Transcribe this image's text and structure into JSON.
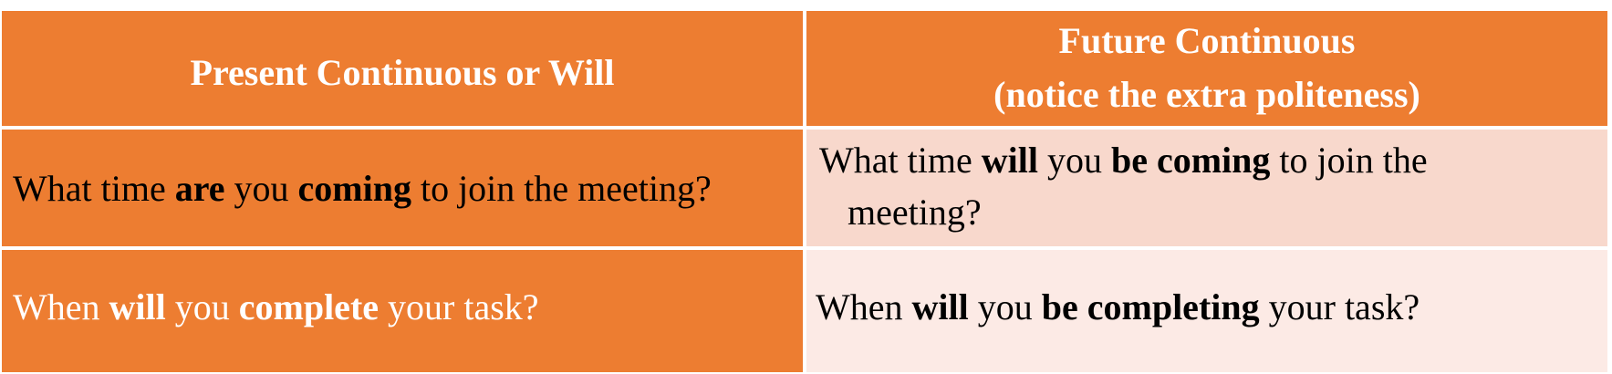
{
  "header": {
    "left": "Present Continuous or Will",
    "right_line1": "Future Continuous",
    "right_line2": "(notice the extra politeness)"
  },
  "rows": [
    {
      "left": {
        "t1": "What time ",
        "b1": "are",
        "t2": " you ",
        "b2": "coming",
        "t3": " to join the meeting?"
      },
      "right": {
        "t1": "What time ",
        "b1": "will",
        "t2": " you ",
        "b2": "be coming",
        "t3": " to join the",
        "t4": "meeting?"
      }
    },
    {
      "left": {
        "t1": "When ",
        "b1": "will",
        "t2": " you ",
        "b2": "complete",
        "t3": " your task?"
      },
      "right": {
        "t1": "When ",
        "b1": "will",
        "t2": " you ",
        "b2": "be completing",
        "t3": " your task?"
      }
    }
  ],
  "colors": {
    "header": "#ED7D31",
    "left_column": "#ED7D31",
    "row1_right": "#F8D8CC",
    "row2_right": "#FCEAE5"
  }
}
